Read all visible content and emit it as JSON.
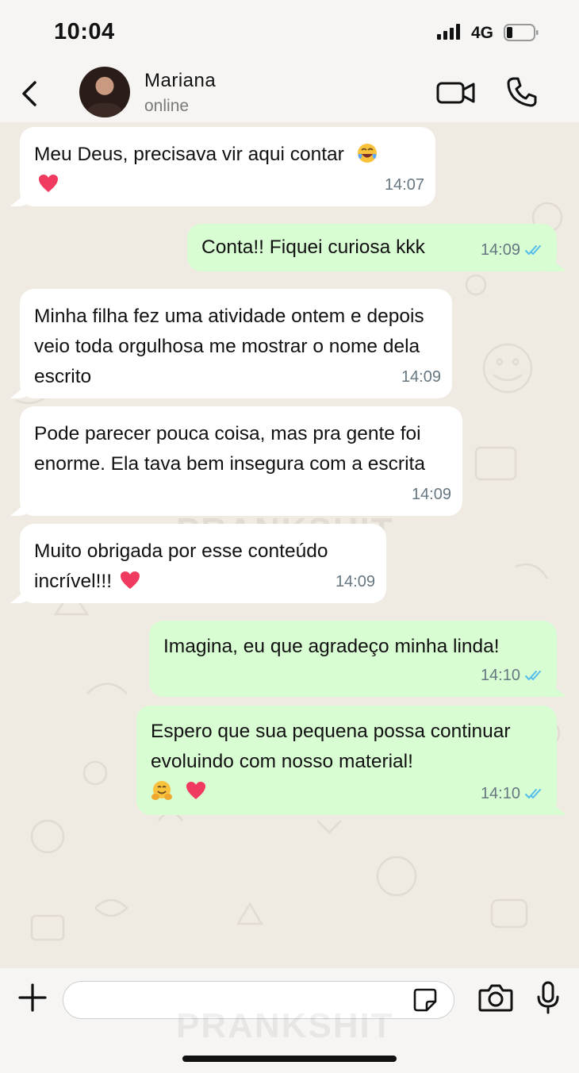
{
  "status_bar": {
    "time": "10:04",
    "network": "4G",
    "signal_icon": "signal-bars-icon",
    "battery_icon": "battery-low-icon"
  },
  "header": {
    "contact_name": "Mariana",
    "presence": "online",
    "back_icon": "chevron-left-icon",
    "video_icon": "video-camera-icon",
    "call_icon": "phone-icon"
  },
  "messages": [
    {
      "direction": "in",
      "text": "Meu Deus, precisava vir aqui contar",
      "emojis": [
        "tears-of-joy-emoji",
        "heart-emoji"
      ],
      "time": "14:07"
    },
    {
      "direction": "out",
      "text": "Conta!! Fiquei curiosa kkk",
      "time": "14:09",
      "status": "read"
    },
    {
      "direction": "in",
      "text": "Minha filha fez uma atividade ontem e depois veio toda orgulhosa me mostrar o nome dela escrito",
      "time": "14:09"
    },
    {
      "direction": "in",
      "text": "Pode parecer pouca coisa, mas pra gente foi enorme. Ela tava bem insegura com a escrita",
      "time": "14:09"
    },
    {
      "direction": "in",
      "text": "Muito obrigada por esse conteúdo incrível!!!",
      "emojis": [
        "heart-emoji"
      ],
      "time": "14:09"
    },
    {
      "direction": "out",
      "text": "Imagina, eu que agradeço minha linda!",
      "time": "14:10",
      "status": "read"
    },
    {
      "direction": "out",
      "text": "Espero que sua pequena possa continuar evoluindo com nosso material!",
      "emojis": [
        "hugging-face-emoji",
        "heart-emoji"
      ],
      "time": "14:10",
      "status": "read"
    }
  ],
  "watermark": "PRANKSHIT",
  "composer": {
    "placeholder": "",
    "plus_icon": "plus-icon",
    "sticker_icon": "sticker-icon",
    "camera_icon": "camera-icon",
    "mic_icon": "microphone-icon"
  },
  "colors": {
    "incoming_bubble": "#ffffff",
    "outgoing_bubble": "#d9fdd3",
    "read_ticks": "#53bdeb",
    "timestamp": "#667781"
  }
}
